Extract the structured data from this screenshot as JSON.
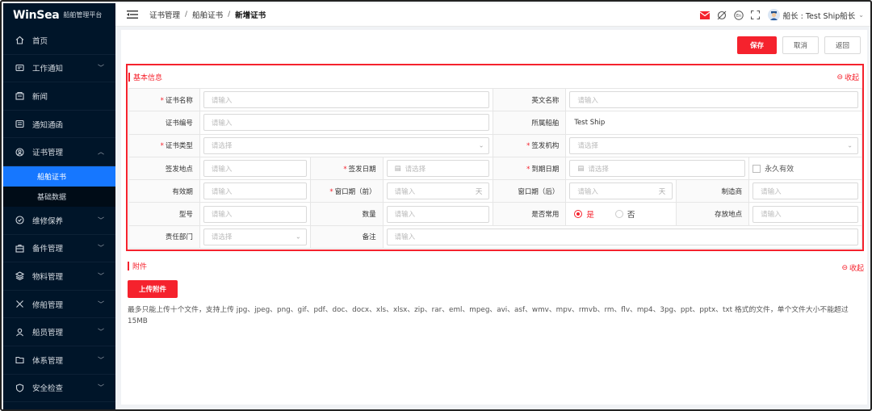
{
  "brand": {
    "name": "WinSea",
    "platform": "船舶管理平台"
  },
  "menu": [
    {
      "label": "首页",
      "icon": "home-icon",
      "expandable": false
    },
    {
      "label": "工作通知",
      "icon": "message-icon",
      "expandable": true
    },
    {
      "label": "新闻",
      "icon": "news-icon",
      "expandable": false
    },
    {
      "label": "通知通函",
      "icon": "notice-icon",
      "expandable": false
    },
    {
      "label": "证书管理",
      "icon": "certificate-icon",
      "expandable": true,
      "expanded": true,
      "children": [
        {
          "label": "船舶证书",
          "active": true
        },
        {
          "label": "基础数据",
          "active": false
        }
      ]
    },
    {
      "label": "维修保养",
      "icon": "maintenance-icon",
      "expandable": true
    },
    {
      "label": "备件管理",
      "icon": "spare-parts-icon",
      "expandable": true
    },
    {
      "label": "物料管理",
      "icon": "materials-icon",
      "expandable": true
    },
    {
      "label": "修船管理",
      "icon": "repair-icon",
      "expandable": true
    },
    {
      "label": "船员管理",
      "icon": "crew-icon",
      "expandable": true
    },
    {
      "label": "体系管理",
      "icon": "system-icon",
      "expandable": true
    },
    {
      "label": "安全检查",
      "icon": "safety-icon",
      "expandable": true
    }
  ],
  "breadcrumb": [
    "证书管理",
    "船舶证书",
    "新增证书"
  ],
  "header": {
    "user": "船长 : Test Ship船长",
    "lang": "En"
  },
  "actions": {
    "save": "保存",
    "cancel": "取消",
    "back": "返回"
  },
  "basic": {
    "title": "基本信息",
    "collapse": "收起",
    "fields": {
      "cert_name": {
        "label": "证书名称",
        "placeholder": "请输入"
      },
      "en_name": {
        "label": "英文名称",
        "placeholder": "请输入"
      },
      "cert_no": {
        "label": "证书编号",
        "placeholder": "请输入"
      },
      "ship": {
        "label": "所属船舶",
        "value": "Test Ship"
      },
      "cert_type": {
        "label": "证书类型",
        "placeholder": "请选择"
      },
      "issuer": {
        "label": "签发机构",
        "placeholder": "请选择"
      },
      "issue_place": {
        "label": "签发地点",
        "placeholder": "请输入"
      },
      "issue_date": {
        "label": "签发日期",
        "placeholder": "请选择"
      },
      "expire_date": {
        "label": "到期日期",
        "placeholder": "请选择"
      },
      "permanent": {
        "label": "永久有效"
      },
      "validity": {
        "label": "有效期",
        "placeholder": "请输入"
      },
      "window_before": {
        "label": "窗口期（前）",
        "placeholder": "请输入",
        "suffix": "天"
      },
      "window_after": {
        "label": "窗口期（后）",
        "placeholder": "请输入",
        "suffix": "天"
      },
      "manufacturer": {
        "label": "制造商",
        "placeholder": "请输入"
      },
      "model": {
        "label": "型号",
        "placeholder": "请输入"
      },
      "quantity": {
        "label": "数量",
        "placeholder": "请输入"
      },
      "common": {
        "label": "是否常用",
        "yes": "是",
        "no": "否",
        "selected": "是"
      },
      "location": {
        "label": "存放地点",
        "placeholder": "请输入"
      },
      "department": {
        "label": "责任部门",
        "placeholder": "请选择"
      },
      "remark": {
        "label": "备注",
        "placeholder": "请输入"
      }
    }
  },
  "attachments": {
    "title": "附件",
    "collapse": "收起",
    "upload": "上传附件",
    "hint": "最多只能上传十个文件，支持上传 jpg、jpeg、png、gif、pdf、doc、docx、xls、xlsx、zip、rar、eml、mpeg、avi、asf、wmv、mpv、rmvb、rm、flv、mp4、3pg、ppt、pptx、txt 格式的文件，单个文件大小不能超过15MB"
  },
  "colors": {
    "accent": "#f5222d",
    "sidebar": "#001529",
    "active": "#1677ff"
  }
}
